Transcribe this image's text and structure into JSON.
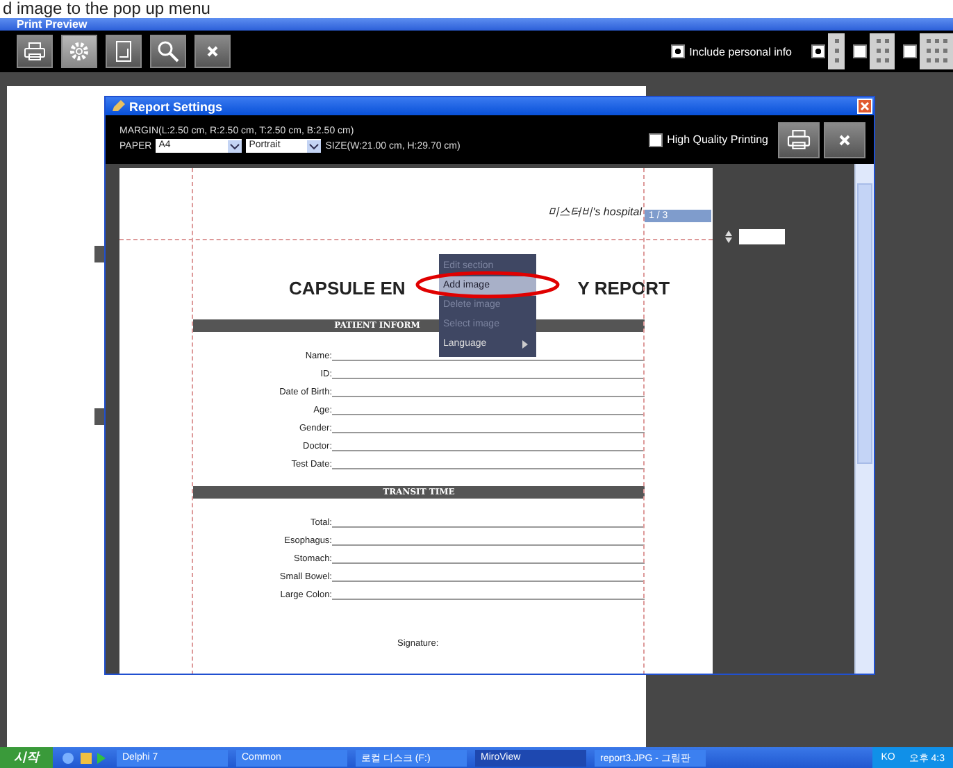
{
  "caption": "d image to the pop up menu",
  "window": {
    "title": "Print Preview"
  },
  "toolbar": [
    {
      "kind": "print",
      "selected": false
    },
    {
      "kind": "settings",
      "selected": true
    },
    {
      "kind": "page",
      "selected": false
    },
    {
      "kind": "zoom",
      "selected": false
    },
    {
      "kind": "close",
      "selected": false
    }
  ],
  "include_personal_info": {
    "label": "Include personal info",
    "checked": true
  },
  "layouts": [
    {
      "kind": "one",
      "checked": true
    },
    {
      "kind": "two",
      "checked": false
    },
    {
      "kind": "three",
      "checked": false
    }
  ],
  "dialog": {
    "title": "Report Settings",
    "margin": "MARGIN(L:2.50 cm, R:2.50 cm, T:2.50 cm, B:2.50 cm)",
    "paper_label": "PAPER",
    "paper": "A4",
    "orientation": "Portrait",
    "size": "SIZE(W:21.00 cm, H:29.70 cm)",
    "high_quality": {
      "label": "High Quality Printing",
      "checked": false
    },
    "page": {
      "hospital": "미스터비's hospital",
      "page_indicator": "1 / 3",
      "title_parts": [
        "CAPSULE EN",
        "Y REPORT"
      ],
      "patient_band": "PATIENT INFORM",
      "patient_fields": [
        "Name:",
        "ID:",
        "Date of Birth:",
        "Age:",
        "Gender:",
        "Doctor:",
        "Test Date:"
      ],
      "transit_band": "TRANSIT TIME",
      "transit_fields": [
        "Total:",
        "Esophagus:",
        "Stomach:",
        "Small Bowel:",
        "Large Colon:"
      ],
      "signature": "Signature:"
    },
    "context_menu": [
      {
        "label": "Edit section",
        "disabled": true,
        "selected": false,
        "submenu": false
      },
      {
        "label": "Add image",
        "disabled": false,
        "selected": true,
        "submenu": false
      },
      {
        "label": "Delete image",
        "disabled": true,
        "selected": false,
        "submenu": false
      },
      {
        "label": "Select image",
        "disabled": true,
        "selected": false,
        "submenu": false
      },
      {
        "label": "Language",
        "disabled": false,
        "selected": false,
        "submenu": true
      }
    ]
  },
  "taskbar": {
    "start": "시작",
    "tasks": [
      {
        "label": "Delphi 7",
        "selected": false
      },
      {
        "label": "Common",
        "selected": false
      },
      {
        "label": "로컬 디스크 (F:)",
        "selected": false
      },
      {
        "label": "MiroView",
        "selected": true
      },
      {
        "label": "report3.JPG - 그림판",
        "selected": false
      }
    ],
    "language": "KO",
    "clock": "오후 4:3"
  }
}
